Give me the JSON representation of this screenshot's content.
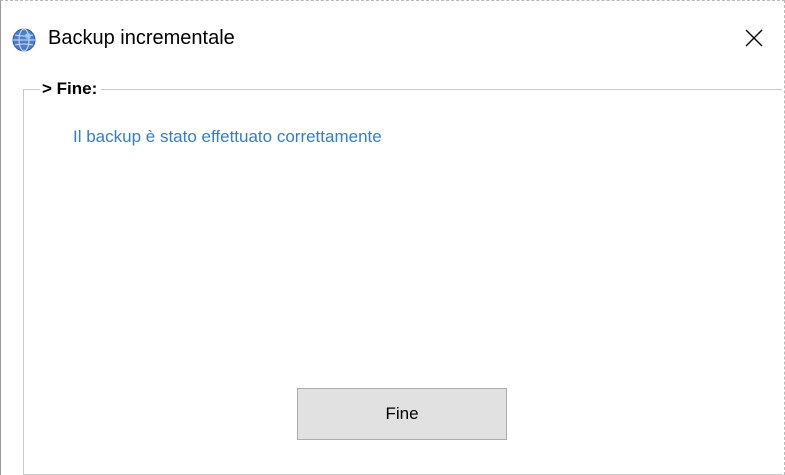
{
  "window": {
    "title": "Backup incrementale",
    "app_icon": "backup-globe-icon",
    "close_icon": "close-icon"
  },
  "group": {
    "legend": "> Fine:",
    "message": "Il backup è stato effettuato correttamente"
  },
  "buttons": {
    "finish_label": "Fine"
  },
  "colors": {
    "message_text": "#2f7fd4",
    "button_face": "#e1e1e1",
    "button_border": "#adadad",
    "group_border": "#c8c8c8"
  }
}
